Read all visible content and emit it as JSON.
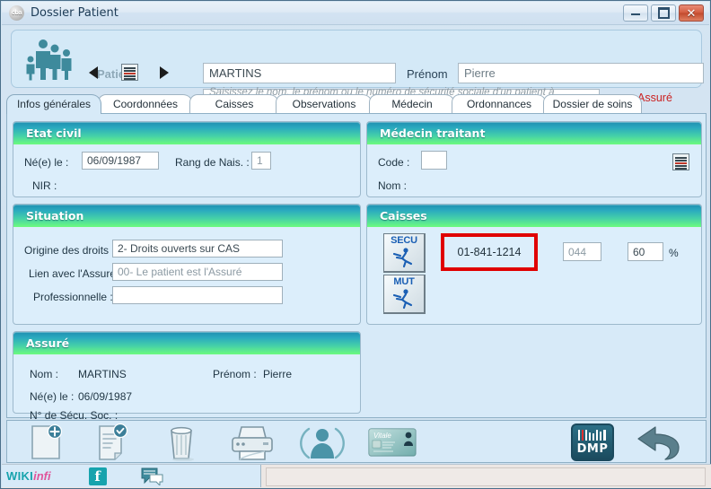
{
  "window": {
    "title": "Dossier Patient",
    "icon_label": "cba",
    "controls": {
      "minimize": "minimize-icon",
      "maximize": "maximize-icon",
      "close": "close-icon"
    }
  },
  "header": {
    "family_icon": "family-icon",
    "patient_label": "Patient",
    "nom_value": "MARTINS",
    "prenom_label": "Prénom",
    "prenom_value": "Pierre",
    "search_placeholder": "Saisissez le nom, le prénom ou le numéro de sécurité sociale d'un patient à rechercher",
    "search_value": "",
    "assure_status": "Assuré",
    "prev_icon": "previous-arrow-icon",
    "card_icon": "vitale-card-reader-icon",
    "next_icon": "next-arrow-icon"
  },
  "tabs": [
    {
      "label": "Infos générales",
      "active": true
    },
    {
      "label": "Coordonnées",
      "active": false
    },
    {
      "label": "Caisses",
      "active": false
    },
    {
      "label": "Observations",
      "active": false
    },
    {
      "label": "Médecin",
      "active": false
    },
    {
      "label": "Ordonnances",
      "active": false
    },
    {
      "label": "Dossier de soins",
      "active": false
    }
  ],
  "panels": {
    "etat_civil": {
      "title": "Etat civil",
      "ne_le_label": "Né(e) le :",
      "ne_le_value": "06/09/1987",
      "rang_label": "Rang de Nais. :",
      "rang_value": "1",
      "nir_label": "NIR :",
      "nir_value": ""
    },
    "medecin_traitant": {
      "title": "Médecin traitant",
      "code_label": "Code :",
      "code_value": "",
      "nom_label": "Nom :",
      "nom_value": "",
      "card_icon": "card-reader-icon"
    },
    "situation": {
      "title": "Situation",
      "origine_label": "Origine des droits :",
      "origine_value": "2- Droits ouverts sur CAS",
      "lien_label": "Lien avec l'Assuré :",
      "lien_value": "00- Le patient est l'Assuré",
      "pro_label": "Professionnelle :",
      "pro_value": ""
    },
    "caisses": {
      "title": "Caisses",
      "secu_button": "SECU",
      "mut_button": "MUT",
      "caisse_number": "01-841-1214",
      "centre_value": "044",
      "taux_value": "60",
      "percent_label": "%"
    },
    "assure": {
      "title": "Assuré",
      "nom_label": "Nom :",
      "nom_value": "MARTINS",
      "prenom_label": "Prénom :",
      "prenom_value": "Pierre",
      "ne_le_label": "Né(e) le :",
      "ne_le_value": "06/09/1987",
      "secu_label": "N° de Sécu. Soc. :",
      "secu_value": ""
    }
  },
  "toolbar": [
    {
      "name": "new-document-icon"
    },
    {
      "name": "edit-document-icon"
    },
    {
      "name": "delete-trash-icon"
    },
    {
      "name": "print-icon"
    },
    {
      "name": "patient-profile-icon"
    },
    {
      "name": "vitale-card-icon"
    },
    {
      "name": "dmp-icon",
      "label": "DMP"
    },
    {
      "name": "back-arrow-icon"
    }
  ],
  "statusbar": {
    "wiki_part1": "WIKI",
    "wiki_part2": "infi",
    "facebook_label": "f",
    "chat_icon": "chat-bubble-icon",
    "message": ""
  },
  "colors": {
    "panel_header_start": "#1f8fb0",
    "panel_header_end": "#6dfb7e",
    "highlight_red": "#e00000",
    "assure_red": "#cc2222",
    "teal": "#17a3ad",
    "pink": "#e0559b",
    "panel_bg": "#dceefb",
    "content_bg": "#d7eaf8"
  }
}
